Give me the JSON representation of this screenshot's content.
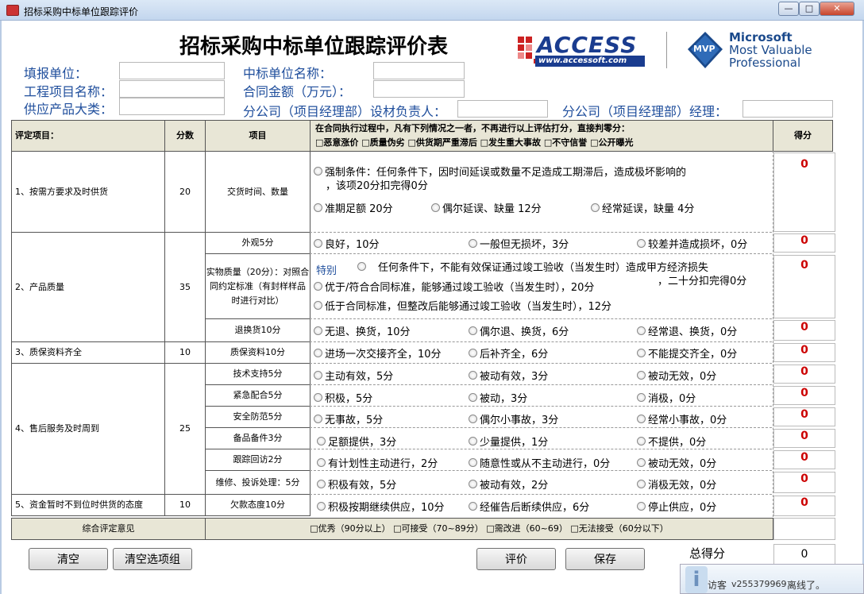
{
  "window": {
    "title": "招标采购中标单位跟踪评价",
    "min": "—",
    "max": "□",
    "close": "✕"
  },
  "form": {
    "title": "招标采购中标单位跟踪评价表",
    "labels": {
      "unit": "填报单位：",
      "project": "工程项目名称：",
      "category": "供应产品大类：",
      "winner": "中标单位名称：",
      "amount": "合同金额（万元）：",
      "branch_mgr": "分公司（项目经理部）设材负责人：",
      "branch_manager": "分公司（项目经理部）经理："
    }
  },
  "logo": {
    "access": "ACCESS",
    "access_url": "www.accessoft.com",
    "mvp": "MVP",
    "ms1": "Microsoft",
    "ms2": "Most Valuable",
    "ms3": "Professional"
  },
  "header": {
    "item": "评定项目：",
    "score": "分数",
    "sub": "项目",
    "cond1": "在合同执行过程中，凡有下列情况之一者，不再进行以上评估打分，直接判零分：",
    "cond2": "□恶意涨价 □质量伪劣 □供货期严重滞后 □发生重大事故 □不守信誉 □公开曝光",
    "result": "得分"
  },
  "items": {
    "i1": "1、按需方要求及时供货",
    "s1": "20",
    "i2": "2、产品质量",
    "s2": "35",
    "i3": "3、质保资料齐全",
    "s3": "10",
    "i4": "4、售后服务及时周到",
    "s4": "25",
    "i5": "5、资金暂时不到位时供货的态度",
    "s5": "10"
  },
  "subs": {
    "a": "交货时间、数量",
    "b": "外观5分",
    "c": "实物质量（20分）：对照合同约定标准（有封样样品时进行对比）",
    "d": "退换货10分",
    "e": "质保资料10分",
    "f": "技术支持5分",
    "g": "紧急配合5分",
    "h": "安全防范5分",
    "i": "备品备件3分",
    "j": "跟踪回访2分",
    "k": "维修、投诉处理：5分",
    "l": "欠款态度10分"
  },
  "opts": {
    "a1": "强制条件：任何条件下，因时间延误或数量不足造成工期滞后，造成极坏影响的",
    "a1b": "，该项20分扣完得0分",
    "a2": "准期足额 20分",
    "a3": "偶尔延误、缺量 12分",
    "a4": "经常延误，缺量 4分",
    "b1": "良好，10分",
    "b2": "一般但无损坏，3分",
    "b3": "较差并造成损坏，0分",
    "c0": "特别",
    "c1": "任何条件下，不能有效保证通过竣工验收（当发生时）造成甲方经济损失",
    "c1b": "，二十分扣完得0分",
    "c2": "优于/符合合同标准，能够通过竣工验收（当发生时），20分",
    "c3": "低于合同标准，但整改后能够通过竣工验收（当发生时），12分",
    "d1": "无退、换货，10分",
    "d2": "偶尔退、换货，6分",
    "d3": "经常退、换货，0分",
    "e1": "进场一次交接齐全，10分",
    "e2": "后补齐全，6分",
    "e3": "不能提交齐全，0分",
    "f1": "主动有效，5分",
    "f2": "被动有效，3分",
    "f3": "被动无效，0分",
    "g1": "积极，5分",
    "g2": "被动，3分",
    "g3": "消极，0分",
    "h1": "无事故，5分",
    "h2": "偶尔小事故，3分",
    "h3": "经常小事故，0分",
    "i1": "足额提供，3分",
    "i2": "少量提供，1分",
    "i3": "不提供，0分",
    "j1": "有计划性主动进行，2分",
    "j2": "随意性或从不主动进行，0分",
    "j3": "被动无效，0分",
    "k1": "积极有效，5分",
    "k2": "被动有效，2分",
    "k3": "消极无效，0分",
    "l1": "积极按期继续供应，10分",
    "l2": "经催告后断续供应，6分",
    "l3": "停止供应，0分"
  },
  "scores": [
    "0",
    "0",
    "0",
    "0",
    "0",
    "0",
    "0",
    "0",
    "0",
    "0",
    "0",
    "0"
  ],
  "summary": {
    "label": "综合评定意见",
    "options": "□优秀（90分以上） □可接受（70~89分） □需改进（60~69） □无法接受（60分以下）"
  },
  "buttons": {
    "clear": "清空",
    "clear_group": "清空选项组",
    "evaluate": "评价",
    "save": "保存"
  },
  "total": {
    "label": "总得分",
    "value": "0"
  },
  "status": {
    "visit": "访客",
    "user": "v255379969",
    "state": "离线了。"
  }
}
